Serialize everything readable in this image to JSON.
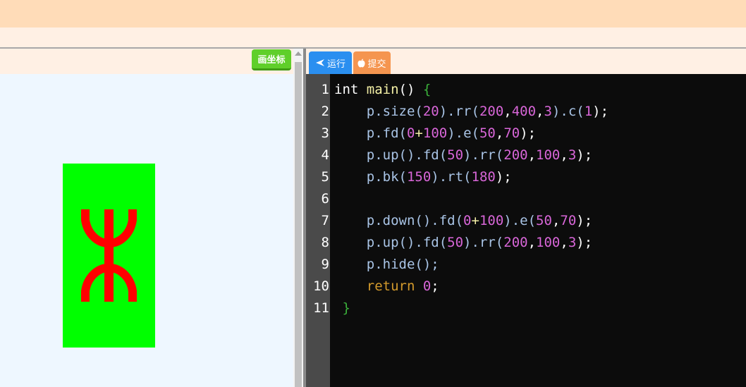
{
  "header": {},
  "toolbar": {
    "draw_axes_label": "画坐标",
    "run_label": "运行",
    "submit_label": "提交"
  },
  "colors": {
    "top_bar": "#ffdcb8",
    "canvas_bg": "#eef7ff",
    "editor_bg": "#0c0c0c",
    "drawing_rect": "#00ff00",
    "drawing_strokes": "#ff0000",
    "run_button": "#2a8ff0",
    "submit_button": "#f5954f",
    "draw_axes_button": "#5fcf2a"
  },
  "icons": {
    "run": "send-arrow-icon",
    "submit": "apple-icon"
  },
  "editor": {
    "line_numbers": [
      "1",
      "2",
      "3",
      "4",
      "5",
      "6",
      "7",
      "8",
      "9",
      "10",
      "11"
    ],
    "lines": [
      [
        {
          "t": "int ",
          "c": "kw"
        },
        {
          "t": "main",
          "c": "fn"
        },
        {
          "t": "() ",
          "c": "kw"
        },
        {
          "t": "{",
          "c": "brace"
        }
      ],
      [
        {
          "t": "    p",
          "c": "id"
        },
        {
          "t": ".size(",
          "c": "id"
        },
        {
          "t": "20",
          "c": "num"
        },
        {
          "t": ").rr(",
          "c": "id"
        },
        {
          "t": "200",
          "c": "num"
        },
        {
          "t": ",",
          "c": "kw"
        },
        {
          "t": "400",
          "c": "num"
        },
        {
          "t": ",",
          "c": "kw"
        },
        {
          "t": "3",
          "c": "num"
        },
        {
          "t": ").c(",
          "c": "id"
        },
        {
          "t": "1",
          "c": "num"
        },
        {
          "t": ");",
          "c": "kw"
        }
      ],
      [
        {
          "t": "    p",
          "c": "id"
        },
        {
          "t": ".fd(",
          "c": "id"
        },
        {
          "t": "0",
          "c": "num"
        },
        {
          "t": "+",
          "c": "op"
        },
        {
          "t": "100",
          "c": "num"
        },
        {
          "t": ").e(",
          "c": "id"
        },
        {
          "t": "50",
          "c": "num"
        },
        {
          "t": ",",
          "c": "kw"
        },
        {
          "t": "70",
          "c": "num"
        },
        {
          "t": ");",
          "c": "kw"
        }
      ],
      [
        {
          "t": "    p",
          "c": "id"
        },
        {
          "t": ".up().fd(",
          "c": "id"
        },
        {
          "t": "50",
          "c": "num"
        },
        {
          "t": ").rr(",
          "c": "id"
        },
        {
          "t": "200",
          "c": "num"
        },
        {
          "t": ",",
          "c": "kw"
        },
        {
          "t": "100",
          "c": "num"
        },
        {
          "t": ",",
          "c": "kw"
        },
        {
          "t": "3",
          "c": "num"
        },
        {
          "t": ");",
          "c": "kw"
        }
      ],
      [
        {
          "t": "    p",
          "c": "id"
        },
        {
          "t": ".bk(",
          "c": "id"
        },
        {
          "t": "150",
          "c": "num"
        },
        {
          "t": ").rt(",
          "c": "id"
        },
        {
          "t": "180",
          "c": "num"
        },
        {
          "t": ");",
          "c": "kw"
        }
      ],
      [],
      [
        {
          "t": "    p",
          "c": "id"
        },
        {
          "t": ".down().fd(",
          "c": "id"
        },
        {
          "t": "0",
          "c": "num"
        },
        {
          "t": "+",
          "c": "op"
        },
        {
          "t": "100",
          "c": "num"
        },
        {
          "t": ").e(",
          "c": "id"
        },
        {
          "t": "50",
          "c": "num"
        },
        {
          "t": ",",
          "c": "kw"
        },
        {
          "t": "70",
          "c": "num"
        },
        {
          "t": ");",
          "c": "kw"
        }
      ],
      [
        {
          "t": "    p",
          "c": "id"
        },
        {
          "t": ".up().fd(",
          "c": "id"
        },
        {
          "t": "50",
          "c": "num"
        },
        {
          "t": ").rr(",
          "c": "id"
        },
        {
          "t": "200",
          "c": "num"
        },
        {
          "t": ",",
          "c": "kw"
        },
        {
          "t": "100",
          "c": "num"
        },
        {
          "t": ",",
          "c": "kw"
        },
        {
          "t": "3",
          "c": "num"
        },
        {
          "t": ");",
          "c": "kw"
        }
      ],
      [
        {
          "t": "    p",
          "c": "id"
        },
        {
          "t": ".hide();",
          "c": "id"
        }
      ],
      [
        {
          "t": "    return ",
          "c": "ret"
        },
        {
          "t": "0",
          "c": "num"
        },
        {
          "t": ";",
          "c": "kw"
        }
      ],
      [
        {
          "t": " }",
          "c": "brace"
        }
      ]
    ]
  }
}
